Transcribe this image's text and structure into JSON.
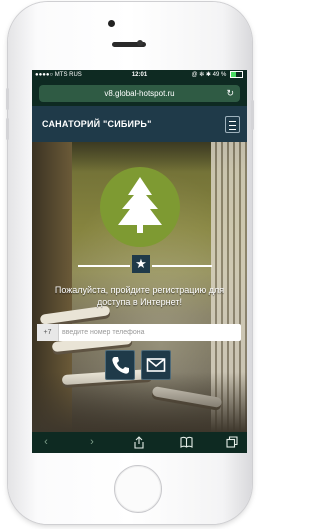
{
  "status_bar": {
    "carrier": "●●●●○ MTS RUS",
    "wifi_icon": "wifi-icon",
    "time": "12:01",
    "indicators": "@ ✻ ✱",
    "battery_text": "49 %"
  },
  "browser": {
    "url": "v8.global-hotspot.ru",
    "reload_icon": "reload-icon"
  },
  "header": {
    "title": "САНАТОРИЙ \"СИБИРЬ\"",
    "menu_icon": "hamburger-icon"
  },
  "hero": {
    "logo_icon": "fir-tree-icon",
    "star_icon": "star-icon",
    "prompt_line1": "Пожалуйста, пройдите регистрацию для",
    "prompt_line2": "доступа в Интернет!"
  },
  "phone_form": {
    "prefix": "+7",
    "placeholder": "введите номер телефона",
    "value": ""
  },
  "auth_buttons": {
    "phone_icon": "phone-icon",
    "mail_icon": "mail-icon"
  },
  "toolbar": {
    "icons": [
      "back-icon",
      "forward-icon",
      "share-icon",
      "bookmarks-icon",
      "tabs-icon"
    ]
  },
  "colors": {
    "header_bg": "#1f3a49",
    "browser_bg": "#0e2a22",
    "logo_green": "#7e9a32",
    "url_field": "#2f5b44"
  }
}
